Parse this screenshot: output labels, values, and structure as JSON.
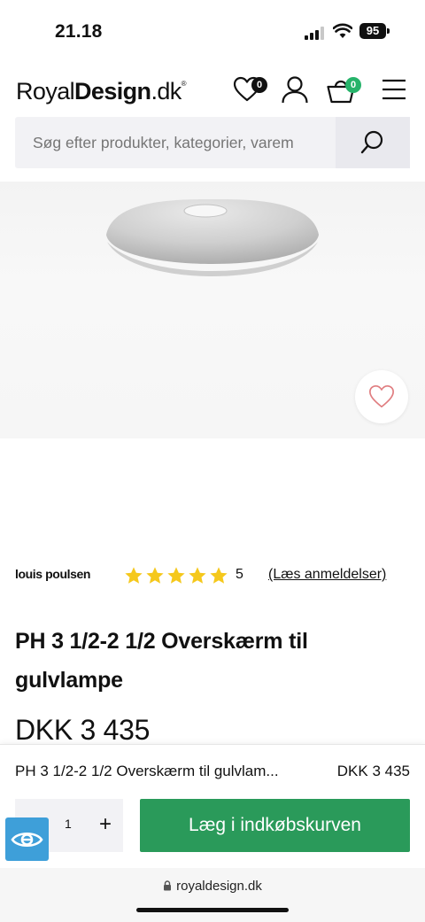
{
  "status": {
    "time": "21.18",
    "battery": "95"
  },
  "header": {
    "logo_regular": "Royal",
    "logo_bold": "Design",
    "logo_suffix": ".dk",
    "logo_mark": "®",
    "wishlist_count": "0",
    "cart_count": "0",
    "accent_color": "#26b36a"
  },
  "search": {
    "placeholder": "Søg efter produkter, kategorier, varem"
  },
  "product": {
    "brand": "louis poulsen",
    "rating": 5,
    "rating_label": "5",
    "reviews_link": "(Læs anmeldelser)",
    "title": "PH 3 1/2-2 1/2 Overskærm til gulvlampe",
    "price": "DKK 3 435"
  },
  "sticky_bar": {
    "name": "PH 3 1/2-2 1/2 Overskærm til gulvlam...",
    "price": "DKK 3 435",
    "quantity": "1",
    "plus": "+",
    "add_to_cart": "Læg i indkøbskurven",
    "button_color": "#2a9a5a"
  },
  "browser": {
    "url": "royaldesign.dk"
  },
  "colors": {
    "star": "#f5c81c",
    "heart": "#e07d80",
    "a11y_badge": "#3e9fd9"
  },
  "icons": [
    "heart-icon",
    "user-icon",
    "basket-icon",
    "menu-icon",
    "search-icon",
    "star-icon",
    "lock-icon",
    "eye-icon"
  ]
}
